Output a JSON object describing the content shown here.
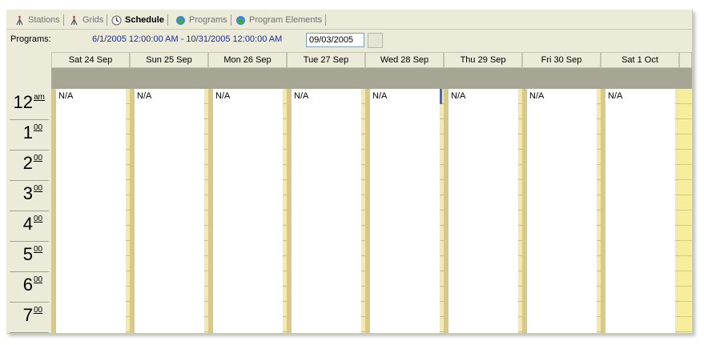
{
  "tabs": [
    {
      "label": "Stations",
      "icon": "antenna-icon",
      "active": false
    },
    {
      "label": "Grids",
      "icon": "antenna-icon",
      "active": false
    },
    {
      "label": "Schedule",
      "icon": "clock-icon",
      "active": true
    },
    {
      "label": "Programs",
      "icon": "globe-icon",
      "active": false
    },
    {
      "label": "Program Elements",
      "icon": "globe-icon",
      "active": false
    }
  ],
  "programs": {
    "label": "Programs:",
    "range": "6/1/2005 12:00:00 AM - 10/31/2005 12:00:00 AM",
    "date_value": "09/03/2005"
  },
  "days": [
    {
      "label": "Sat 24 Sep",
      "entry": "N/A"
    },
    {
      "label": "Sun 25 Sep",
      "entry": "N/A"
    },
    {
      "label": "Mon 26 Sep",
      "entry": "N/A"
    },
    {
      "label": "Tue 27 Sep",
      "entry": "N/A"
    },
    {
      "label": "Wed 28 Sep",
      "entry": "N/A"
    },
    {
      "label": "Thu 29 Sep",
      "entry": "N/A"
    },
    {
      "label": "Fri 30 Sep",
      "entry": "N/A"
    },
    {
      "label": "Sat 1 Oct",
      "entry": "N/A"
    }
  ],
  "hours": [
    {
      "h": "12",
      "m": "am"
    },
    {
      "h": "1",
      "m": "00"
    },
    {
      "h": "2",
      "m": "00"
    },
    {
      "h": "3",
      "m": "00"
    },
    {
      "h": "4",
      "m": "00"
    },
    {
      "h": "5",
      "m": "00"
    },
    {
      "h": "6",
      "m": "00"
    },
    {
      "h": "7",
      "m": "00"
    }
  ],
  "colors": {
    "range_text": "#1a2e9b",
    "selection_marker": "#3a6bc6"
  }
}
